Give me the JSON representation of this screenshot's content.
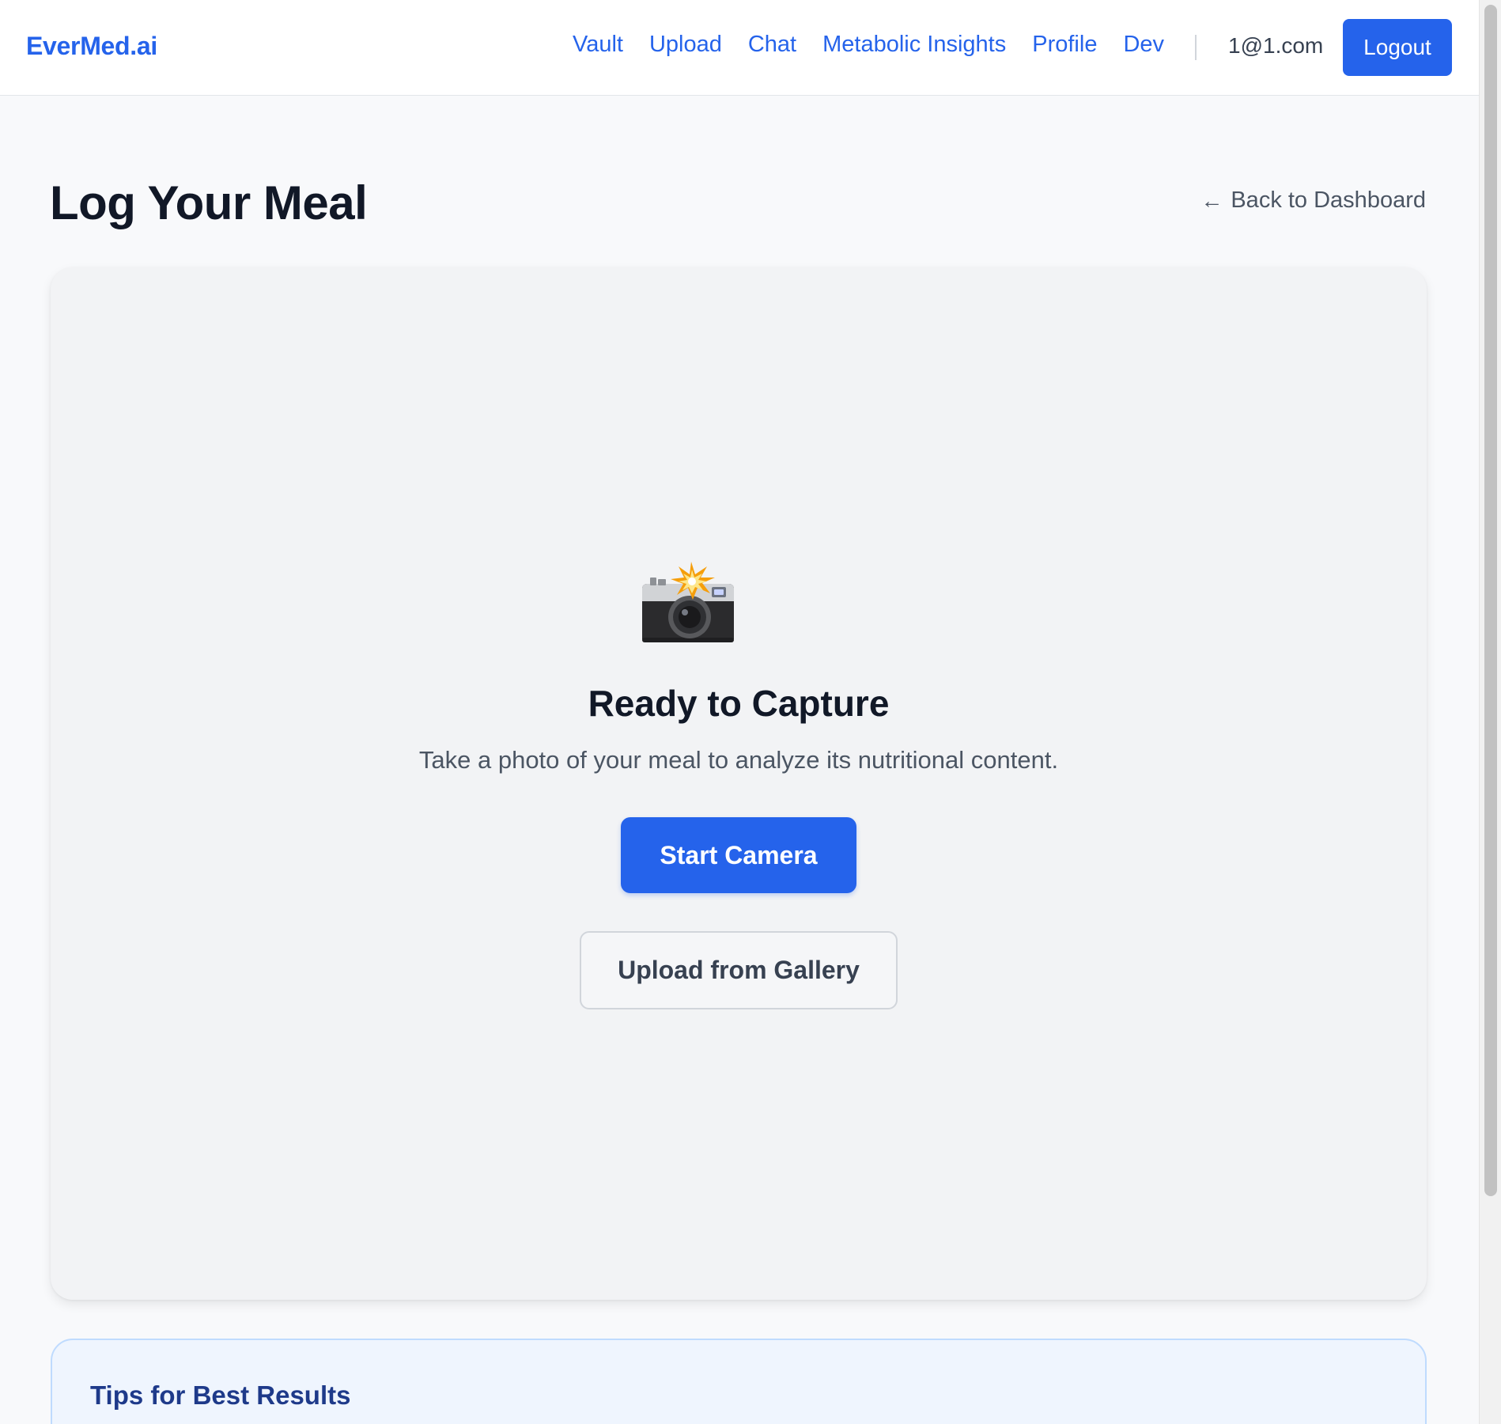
{
  "header": {
    "brand": "EverMed.ai",
    "nav": [
      "Vault",
      "Upload",
      "Chat",
      "Metabolic Insights",
      "Profile",
      "Dev"
    ],
    "user_email": "1@1.com",
    "logout_label": "Logout"
  },
  "main": {
    "title": "Log Your Meal",
    "back_link": "Back to Dashboard",
    "back_arrow": "←"
  },
  "capture": {
    "icon": "camera-flash-icon",
    "title": "Ready to Capture",
    "description": "Take a photo of your meal to analyze its nutritional content.",
    "start_camera_label": "Start Camera",
    "upload_gallery_label": "Upload from Gallery"
  },
  "tips": {
    "title": "Tips for Best Results"
  },
  "colors": {
    "accent": "#2563eb",
    "title_text": "#111827",
    "muted_text": "#4b5563",
    "tips_title": "#1e3a8a",
    "tips_bg": "#eff5fe"
  }
}
